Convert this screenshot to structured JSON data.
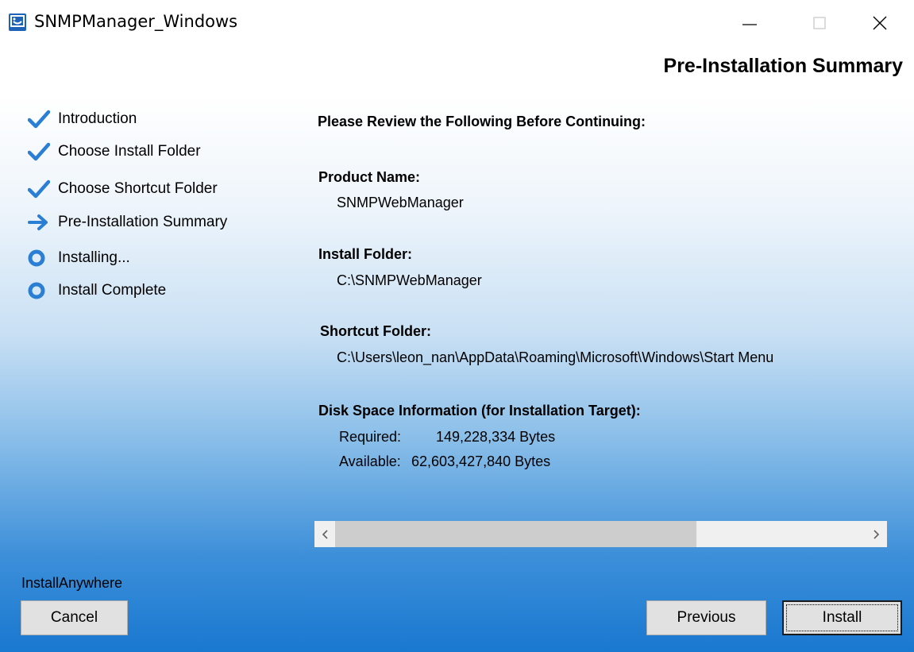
{
  "window": {
    "title": "SNMPManager_Windows"
  },
  "page_title": "Pre-Installation Summary",
  "steps": [
    {
      "label": "Introduction",
      "state": "done",
      "icon": "checkmark-icon"
    },
    {
      "label": "Choose Install Folder",
      "state": "done",
      "icon": "checkmark-icon"
    },
    {
      "label": "Choose Shortcut Folder",
      "state": "done",
      "icon": "checkmark-icon"
    },
    {
      "label": "Pre-Installation Summary",
      "state": "current",
      "icon": "arrow-right-icon"
    },
    {
      "label": "Installing...",
      "state": "pending",
      "icon": "circle-icon"
    },
    {
      "label": "Install Complete",
      "state": "pending",
      "icon": "circle-icon"
    }
  ],
  "summary": {
    "heading": "Please Review the Following Before Continuing:",
    "product_name_label": "Product Name:",
    "product_name_value": "SNMPWebManager",
    "install_folder_label": "Install Folder:",
    "install_folder_value": "C:\\SNMPWebManager",
    "shortcut_folder_label": "Shortcut Folder:",
    "shortcut_folder_value": "C:\\Users\\leon_nan\\AppData\\Roaming\\Microsoft\\Windows\\Start Menu",
    "disk_space_label": "Disk Space Information (for Installation Target):",
    "required_label": "Required:",
    "required_value": "149,228,334 Bytes",
    "available_label": "Available:",
    "available_value": "62,603,427,840 Bytes"
  },
  "brand": "InstallAnywhere",
  "buttons": {
    "cancel": "Cancel",
    "previous": "Previous",
    "install": "Install"
  },
  "colors": {
    "accent_blue": "#2a7fd4",
    "gradient_bottom": "#1978d0"
  }
}
